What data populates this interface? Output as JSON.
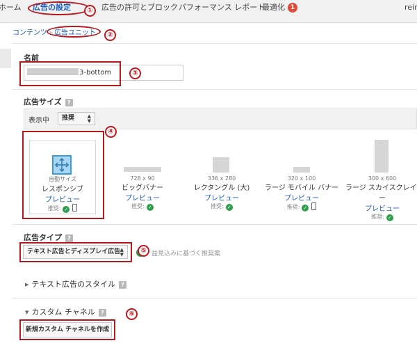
{
  "nav": {
    "items": [
      {
        "label": "ホーム"
      },
      {
        "label": "広告の設定"
      },
      {
        "label": "広告の許可とブロック"
      },
      {
        "label": "パフォーマンス レポート"
      },
      {
        "label": "最適化"
      }
    ],
    "badge": "1",
    "user_fragment": "rein"
  },
  "breadcrumb": {
    "parent": "コンテンツ",
    "separator": "›",
    "current": "広告ユニット"
  },
  "name_section": {
    "label": "名前",
    "value": "3-bottom"
  },
  "size_section": {
    "label": "広告サイズ",
    "help": "?",
    "show_label": "表示中",
    "show_value": "推奨",
    "sizes": [
      {
        "dims": "自動サイズ",
        "name": "レスポンシブ",
        "preview": "プレビュー",
        "rec": "推奨:"
      },
      {
        "dims": "728 x 90",
        "name": "ビッグバナー",
        "preview": "プレビュー",
        "rec": "推奨:"
      },
      {
        "dims": "336 x 280",
        "name": "レクタングル (大)",
        "preview": "プレビュー",
        "rec": "推奨:"
      },
      {
        "dims": "320 x 100",
        "name": "ラージ モバイル バナー",
        "preview": "プレビュー",
        "rec": "推奨:"
      },
      {
        "dims": "300 x 600",
        "name": "ラージ スカイスクレイパ",
        "name2": "ー",
        "preview": "プレビュー",
        "rec": "推奨:"
      }
    ]
  },
  "ad_type_section": {
    "label": "広告タイプ",
    "help": "?",
    "value": "テキスト広告とディスプレイ広告",
    "hint": "益見込みに基づく推奨案"
  },
  "text_style": {
    "label": "テキスト広告のスタイル",
    "help": "?"
  },
  "custom_channel": {
    "label": "カスタム チャネル",
    "help": "?",
    "button": "新規カスタム チャネルを作成"
  },
  "annotations": [
    "①",
    "②",
    "③",
    "④",
    "⑤",
    "⑥"
  ],
  "colors": {
    "accent_blue": "#1a5bbf",
    "annotation_red": "#b21a1f",
    "check_green": "#2e9e4d",
    "badge_red": "#dd4b39"
  }
}
